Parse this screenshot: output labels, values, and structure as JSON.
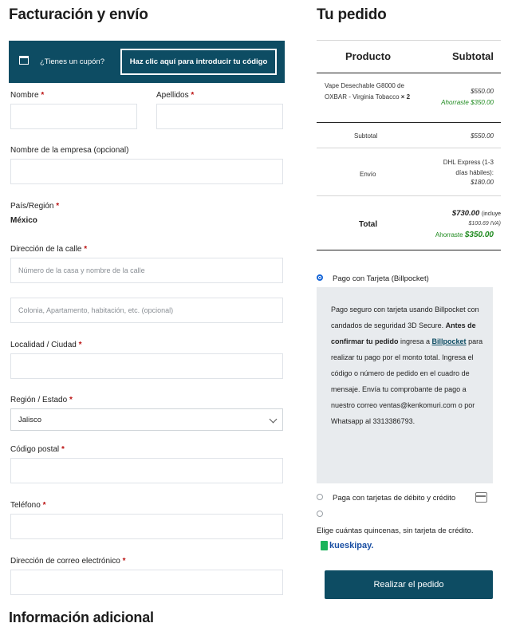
{
  "billing": {
    "title": "Facturación y envío",
    "coupon": {
      "text": "¿Tienes un cupón?",
      "button": "Haz clic aquí para introducir tu código"
    },
    "fields": {
      "nombre": "Nombre",
      "apellidos": "Apellidos",
      "empresa": "Nombre de la empresa (opcional)",
      "pais": "País/Región",
      "pais_value": "México",
      "direccion": "Dirección de la calle",
      "direccion_ph1": "Número de la casa y nombre de la calle",
      "direccion_ph2": "Colonia, Apartamento, habitación, etc. (opcional)",
      "localidad": "Localidad / Ciudad",
      "region": "Región / Estado",
      "region_value": "Jalisco",
      "cp": "Código postal",
      "telefono": "Teléfono",
      "email": "Dirección de correo electrónico"
    },
    "required_mark": "*",
    "additional_title": "Información adicional"
  },
  "order": {
    "title": "Tu pedido",
    "col_product": "Producto",
    "col_subtotal": "Subtotal",
    "item_name": "Vape Desechable G8000 de OXBAR - Virginia Tobacco",
    "item_qty": "× 2",
    "item_price": "$550.00",
    "item_savings": "Ahorraste $350.00",
    "subtotal_label": "Subtotal",
    "subtotal_value": "$550.00",
    "shipping_label": "Envío",
    "shipping_method": "DHL Express (1-3 días hábiles):",
    "shipping_price": "$180.00",
    "total_label": "Total",
    "total_value": "$730.00",
    "total_tax_prefix": "(incluye",
    "total_tax": "$100.69 IVA)",
    "total_savings_label": "Ahorraste",
    "total_savings_value": "$350.00"
  },
  "payment": {
    "option1": "Pago con Tarjeta (Billpocket)",
    "desc_part1": "Pago seguro con tarjeta usando Billpocket con candados de seguridad 3D Secure. ",
    "desc_bold": "Antes de confirmar tu pedido",
    "desc_part2": " ingresa a ",
    "desc_link": "Billpocket",
    "desc_part3": " para realizar tu pago por el monto total. Ingresa el código o número de pedido en el cuadro de mensaje. Envía tu comprobante de pago a nuestro correo ventas@kenkomuri.com o por Whatsapp al 3313386793.",
    "option2": "Paga con tarjetas de débito y crédito",
    "option3_text": "Elige cuántas quincenas, sin tarjeta de crédito.",
    "kueski_logo": "kueskipay.",
    "place_order": "Realizar el pedido"
  },
  "colors": {
    "primary": "#0d4c63",
    "green": "#1e8a1e",
    "required": "#bb1111"
  }
}
